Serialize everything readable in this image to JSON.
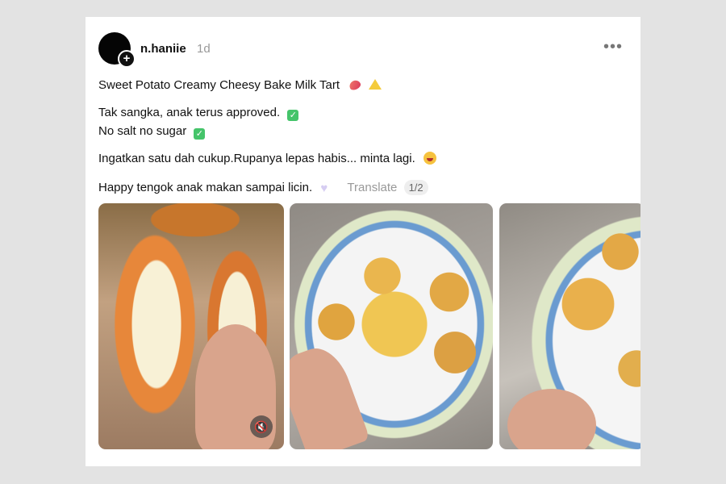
{
  "post": {
    "username": "n.haniie",
    "time": "1d",
    "more_label": "•••",
    "lines": [
      "Sweet Potato Creamy Cheesy Bake Milk Tart",
      "Tak sangka, anak terus approved.",
      "No salt no sugar",
      "Ingatkan satu dah cukup.Rupanya lepas habis... minta lagi.",
      "Happy tengok anak makan sampai licin."
    ],
    "translate_label": "Translate",
    "pager": "1/2",
    "mute_icon": "🔇"
  },
  "icons": {
    "line1": [
      "sweet-potato-icon",
      "cheese-icon"
    ],
    "line2": "check-icon",
    "line3": "check-icon",
    "line4": "laughing-face-icon",
    "line5": "heart-icon"
  },
  "colors": {
    "background": "#e3e3e3",
    "card": "#ffffff",
    "muted_text": "#999999",
    "check": "#45c46a"
  }
}
